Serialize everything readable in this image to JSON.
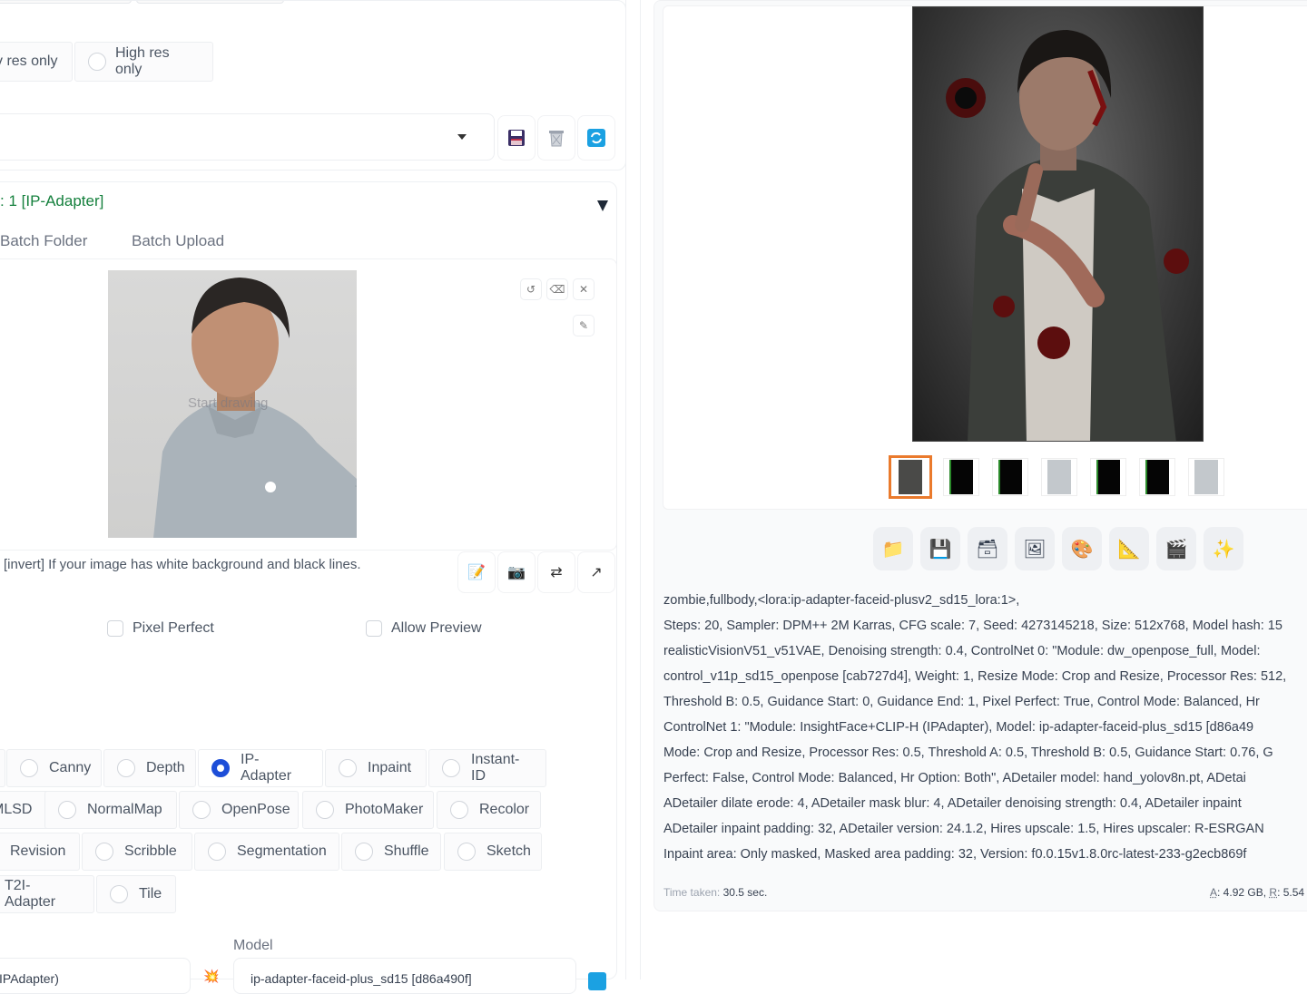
{
  "left": {
    "resize_radio": {
      "options": [
        {
          "label": "v res only",
          "checked": false
        },
        {
          "label": "High res only",
          "checked": false
        }
      ]
    },
    "preset": {
      "value": "",
      "buttons": [
        "save-preset",
        "delete-preset",
        "refresh-presets"
      ]
    },
    "unit": {
      "title": ": 1 [IP-Adapter]",
      "tabs": [
        "Batch Folder",
        "Batch Upload"
      ],
      "canvas_hint": "Start drawing",
      "canvas_tools": [
        "undo",
        "eraser",
        "close",
        "brush"
      ],
      "invert_hint": "[invert] If your image has white background and black lines.",
      "action_buttons": [
        "edit",
        "camera",
        "swap",
        "send-dimensions"
      ],
      "checkboxes": [
        {
          "label": "Pixel Perfect",
          "checked": false
        },
        {
          "label": "Allow Preview",
          "checked": false
        }
      ],
      "control_types": [
        {
          "label": "Canny",
          "checked": false
        },
        {
          "label": "Depth",
          "checked": false
        },
        {
          "label": "IP-Adapter",
          "checked": true
        },
        {
          "label": "Inpaint",
          "checked": false
        },
        {
          "label": "Instant-ID",
          "checked": false
        },
        {
          "label": "MLSD",
          "checked": false
        },
        {
          "label": "NormalMap",
          "checked": false
        },
        {
          "label": "OpenPose",
          "checked": false
        },
        {
          "label": "PhotoMaker",
          "checked": false
        },
        {
          "label": "Recolor",
          "checked": false
        },
        {
          "label": "Revision",
          "checked": false
        },
        {
          "label": "Scribble",
          "checked": false
        },
        {
          "label": "Segmentation",
          "checked": false
        },
        {
          "label": "Shuffle",
          "checked": false
        },
        {
          "label": "Sketch",
          "checked": false
        },
        {
          "label": "T2I-Adapter",
          "checked": false
        },
        {
          "label": "Tile",
          "checked": false
        }
      ],
      "preprocessor_value": "IPAdapter)",
      "model_label": "Model",
      "model_value": "ip-adapter-faceid-plus_sd15 [d86a490f]"
    }
  },
  "right": {
    "thumbnails": [
      {
        "kind": "result",
        "selected": true
      },
      {
        "kind": "pose",
        "selected": false
      },
      {
        "kind": "pose",
        "selected": false
      },
      {
        "kind": "portrait",
        "selected": false
      },
      {
        "kind": "pose",
        "selected": false
      },
      {
        "kind": "pose",
        "selected": false
      },
      {
        "kind": "portrait",
        "selected": false
      }
    ],
    "tools": [
      {
        "name": "open-folder",
        "glyph": "📁"
      },
      {
        "name": "save",
        "glyph": "💾"
      },
      {
        "name": "zip",
        "glyph": "🗃"
      },
      {
        "name": "send-to-img2img",
        "glyph": "🖼"
      },
      {
        "name": "send-to-inpaint",
        "glyph": "🎨"
      },
      {
        "name": "send-to-extras",
        "glyph": "📐"
      },
      {
        "name": "send-to-video",
        "glyph": "🎬"
      },
      {
        "name": "upscale",
        "glyph": "✨"
      }
    ],
    "info_lines": [
      "zombie,fullbody,<lora:ip-adapter-faceid-plusv2_sd15_lora:1>,",
      "Steps: 20, Sampler: DPM++ 2M Karras, CFG scale: 7, Seed: 4273145218, Size: 512x768, Model hash: 15",
      "realisticVisionV51_v51VAE, Denoising strength: 0.4, ControlNet 0: \"Module: dw_openpose_full, Model:",
      "control_v11p_sd15_openpose [cab727d4], Weight: 1, Resize Mode: Crop and Resize, Processor Res: 512,",
      "Threshold B: 0.5, Guidance Start: 0, Guidance End: 1, Pixel Perfect: True, Control Mode: Balanced, Hr",
      "ControlNet 1: \"Module: InsightFace+CLIP-H (IPAdapter), Model: ip-adapter-faceid-plus_sd15 [d86a49",
      "Mode: Crop and Resize, Processor Res: 0.5, Threshold A: 0.5, Threshold B: 0.5, Guidance Start: 0.76, G",
      "Perfect: False, Control Mode: Balanced, Hr Option: Both\", ADetailer model: hand_yolov8n.pt, ADetai",
      "ADetailer dilate erode: 4, ADetailer mask blur: 4, ADetailer denoising strength: 0.4, ADetailer inpaint",
      "ADetailer inpaint padding: 32, ADetailer version: 24.1.2, Hires upscale: 1.5, Hires upscaler: R-ESRGAN",
      "Inpaint area: Only masked, Masked area padding: 32, Version: f0.0.15v1.8.0rc-latest-233-g2ecb869f"
    ],
    "time_label": "Time taken:",
    "time_value": "30.5 sec.",
    "vram_a_label": "A",
    "vram_a_value": ": 4.92 GB, ",
    "vram_r_label": "R",
    "vram_r_value": ": 5.54"
  },
  "colors": {
    "accent_green": "#15803d",
    "radio_checked": "#1d4ed8",
    "thumb_selected": "#ea7a2c"
  }
}
